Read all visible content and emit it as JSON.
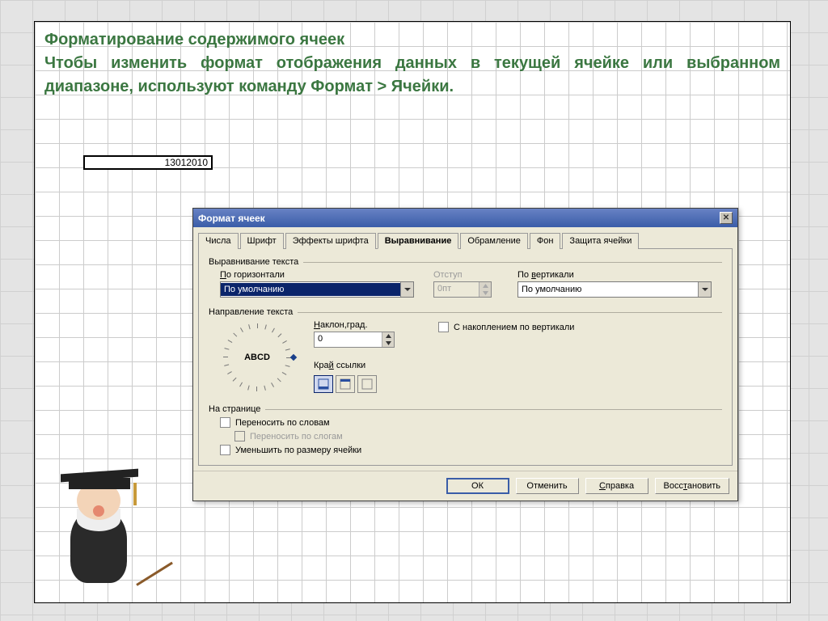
{
  "slide": {
    "p1": "Форматирование содержимого ячеек",
    "p2": "Чтобы изменить формат отображения данных в текущей ячейке или выбранном диапазоне, используют команду Формат > Ячейки."
  },
  "formula_cell": "13012010",
  "dialog": {
    "title": "Формат ячеек",
    "tabs": [
      "Числа",
      "Шрифт",
      "Эффекты шрифта",
      "Выравнивание",
      "Обрамление",
      "Фон",
      "Защита ячейки"
    ],
    "active_tab": 3,
    "groups": {
      "text_align": {
        "title": "Выравнивание текста",
        "horiz_label": "По горизонтали",
        "horiz_value": "По умолчанию",
        "indent_label": "Отступ",
        "indent_value": "0пт",
        "vert_label": "По вертикали",
        "vert_value": "По умолчанию"
      },
      "text_dir": {
        "title": "Направление текста",
        "abcd": "ABCD",
        "tilt_label": "Наклон,град.",
        "tilt_value": "0",
        "stack_label": "С накоплением по вертикали",
        "refedge_label": "Край ссылки"
      },
      "on_page": {
        "title": "На странице",
        "wrap_words": "Переносить по словам",
        "wrap_syll": "Переносить по слогам",
        "shrink": "Уменьшить по размеру ячейки"
      }
    },
    "buttons": {
      "ok": "ОК",
      "cancel": "Отменить",
      "help": "Справка",
      "reset": "Восстановить"
    }
  }
}
